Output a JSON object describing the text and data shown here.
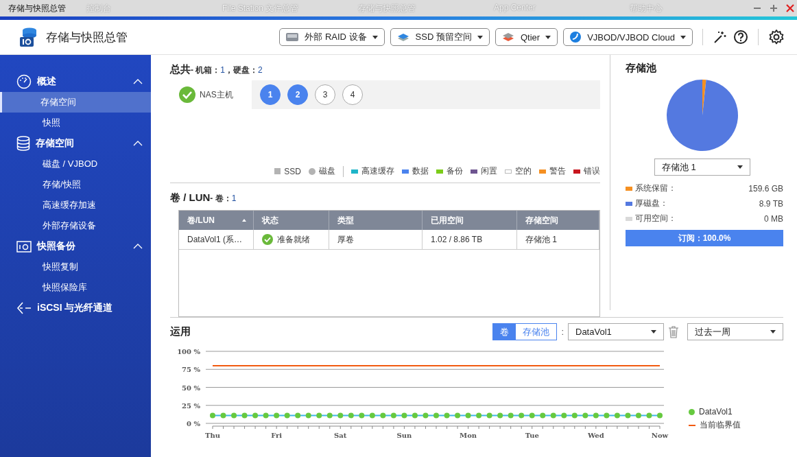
{
  "taskbar_tabs": [
    "控制台",
    "File Station 文件总管",
    "存储与快照总管",
    "App Center",
    "帮助中心"
  ],
  "window": {
    "title": "存储与快照总管"
  },
  "header": {
    "app_name": "存储与快照总管",
    "dropdowns": [
      {
        "label": "外部 RAID 设备",
        "kind": "raid"
      },
      {
        "label": "SSD 预留空间",
        "kind": "ssd"
      },
      {
        "label": "Qtier",
        "kind": "qtier"
      },
      {
        "label": "VJBOD/VJBOD Cloud",
        "kind": "cloud"
      }
    ]
  },
  "sidebar": {
    "sections": [
      {
        "label": "概述",
        "kind": "overview",
        "expanded": true,
        "children": [
          {
            "label": "存储空间",
            "selected": true
          },
          {
            "label": "快照",
            "selected": false
          }
        ]
      },
      {
        "label": "存储空间",
        "kind": "storage",
        "expanded": true,
        "children": [
          {
            "label": "磁盘 / VJBOD",
            "selected": false
          },
          {
            "label": "存储/快照",
            "selected": false
          },
          {
            "label": "高速缓存加速",
            "selected": false
          },
          {
            "label": "外部存储设备",
            "selected": false
          }
        ]
      },
      {
        "label": "快照备份",
        "kind": "snapshot",
        "expanded": true,
        "children": [
          {
            "label": "快照复制",
            "selected": false
          },
          {
            "label": "快照保险库",
            "selected": false
          }
        ]
      },
      {
        "label": "iSCSI 与光纤通道",
        "kind": "iscsi",
        "expanded": false
      }
    ]
  },
  "summary": {
    "title": "总共",
    "chassis_label": "- 机箱：",
    "chassis": "1",
    "disk_label": "，硬盘：",
    "disks": "2",
    "enclosure": "NAS主机",
    "slots": [
      {
        "label": "1",
        "occupied": true
      },
      {
        "label": "2",
        "occupied": true
      },
      {
        "label": "3",
        "occupied": false
      },
      {
        "label": "4",
        "occupied": false
      }
    ],
    "legend": [
      {
        "label": "SSD",
        "kind": "square",
        "color": "#b3b3b3"
      },
      {
        "label": "磁盘",
        "kind": "circle",
        "color": "#b3b3b3"
      },
      {
        "label": "高速缓存",
        "kind": "bar",
        "color": "#1fb5c9"
      },
      {
        "label": "数据",
        "kind": "bar",
        "color": "#4a83ee"
      },
      {
        "label": "备份",
        "kind": "bar",
        "color": "#7ccc1a"
      },
      {
        "label": "闲置",
        "kind": "bar",
        "color": "#6e5590"
      },
      {
        "label": "空的",
        "kind": "empty",
        "color": "#bbbbbb"
      },
      {
        "label": "警告",
        "kind": "bar",
        "color": "#f59022"
      },
      {
        "label": "错误",
        "kind": "bar",
        "color": "#c8161e"
      }
    ]
  },
  "volumes": {
    "title": "卷 / LUN",
    "count_label": "- 卷：",
    "count": "1",
    "columns": [
      "卷/LUN",
      "状态",
      "类型",
      "已用空间",
      "存储空间"
    ],
    "rows": [
      {
        "name": "DataVol1 (系…",
        "status": "准备就绪",
        "type": "厚卷",
        "used": "1.02 / 8.86 TB",
        "pool": "存储池 1"
      }
    ]
  },
  "pool": {
    "title": "存储池",
    "select": "存储池 1",
    "chart_data": {
      "type": "pie",
      "categories": [
        "系统保留",
        "厚磁盘",
        "可用空间"
      ],
      "values": [
        1.7,
        98.3,
        0
      ],
      "colors": [
        "#f59022",
        "#5479e0",
        "#d9d9d9"
      ]
    },
    "label_suffix": "：",
    "legend": [
      {
        "value": "159.6 GB"
      },
      {
        "value": "8.9 TB"
      },
      {
        "value": "0 MB"
      }
    ],
    "subscription": "订阅：100.0%"
  },
  "usage": {
    "title": "运用",
    "toggle": [
      {
        "label": "卷",
        "selected": true
      },
      {
        "label": "存储池",
        "selected": false
      }
    ],
    "separator": ":",
    "volume_select": "DataVol1",
    "period_select": "过去一周",
    "chart_data": {
      "type": "line",
      "categories": [
        "Thu",
        null,
        null,
        null,
        null,
        null,
        "Fri",
        null,
        null,
        null,
        null,
        null,
        "Sat",
        null,
        null,
        null,
        null,
        null,
        "Sun",
        null,
        null,
        null,
        null,
        null,
        "Mon",
        null,
        null,
        null,
        null,
        null,
        "Tue",
        null,
        null,
        null,
        null,
        null,
        "Wed",
        null,
        null,
        null,
        null,
        null,
        "Now"
      ],
      "grid": true,
      "ylim": [
        0,
        100
      ],
      "yticks": [
        {
          "value": 0,
          "label": "0 %"
        },
        {
          "value": 25,
          "label": "25 %"
        },
        {
          "value": 50,
          "label": "50 %"
        },
        {
          "value": 75,
          "label": "75 %"
        },
        {
          "value": 100,
          "label": "100 %"
        }
      ],
      "series": [
        {
          "name": "DataVol1",
          "color": "#66c93f",
          "marker": "circle",
          "values": [
            11,
            11,
            11,
            11,
            11,
            11,
            11,
            11,
            11,
            11,
            11,
            11,
            11,
            11,
            11,
            11,
            11,
            11,
            11,
            11,
            11,
            11,
            11,
            11,
            11,
            11,
            11,
            11,
            11,
            11,
            11,
            11,
            11,
            11,
            11,
            11,
            11,
            11,
            11,
            11,
            11,
            11,
            11
          ]
        },
        {
          "name": "当前临界值",
          "color": "#f25a0f",
          "values": [
            80,
            80,
            80,
            80,
            80,
            80,
            80,
            80,
            80,
            80,
            80,
            80,
            80,
            80,
            80,
            80,
            80,
            80,
            80,
            80,
            80,
            80,
            80,
            80,
            80,
            80,
            80,
            80,
            80,
            80,
            80,
            80,
            80,
            80,
            80,
            80,
            80,
            80,
            80,
            80,
            80,
            80,
            80
          ]
        }
      ]
    }
  }
}
